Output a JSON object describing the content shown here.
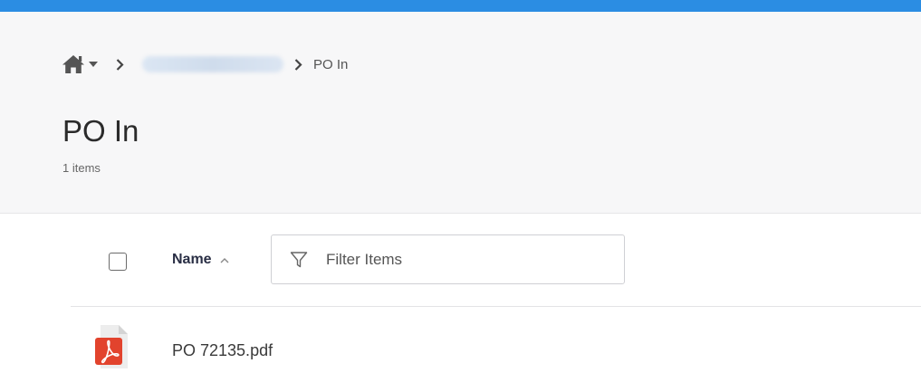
{
  "breadcrumb": {
    "home_icon": "home-icon",
    "caret_icon": "caret-down-icon",
    "separator_icon": "chevron-right-icon",
    "current": "PO In"
  },
  "folder": {
    "title": "PO In",
    "item_count": "1 items"
  },
  "list_header": {
    "name_column": "Name",
    "sort_icon": "sort-ascending-icon",
    "filter_icon": "filter-icon",
    "filter_placeholder": "Filter Items"
  },
  "files": [
    {
      "name": "PO 72135.pdf",
      "icon": "pdf-file-icon"
    }
  ],
  "colors": {
    "accent": "#2b8de3",
    "pdf_red": "#e2432d"
  }
}
